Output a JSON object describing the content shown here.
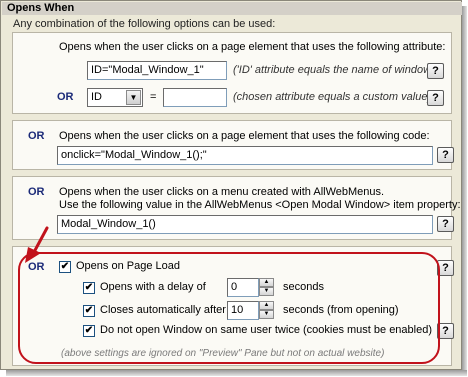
{
  "section": {
    "title": "Opens When",
    "subtitle": "Any combination of the following options can be used:"
  },
  "attribute_panel": {
    "description": "Opens when the user clicks on a page element that uses the following attribute:",
    "id_value": "ID=\"Modal_Window_1\"",
    "id_hint": "('ID' attribute equals the name of window)",
    "or_label": "OR",
    "attribute_select_value": "ID",
    "equals_sign": "=",
    "custom_value": "",
    "custom_hint": "(chosen attribute equals a custom value)"
  },
  "code_panel": {
    "or_label": "OR",
    "description": "Opens when the user clicks on a page element that uses the following code:",
    "code_value": "onclick=\"Modal_Window_1();\""
  },
  "menu_panel": {
    "or_label": "OR",
    "description_line1": "Opens when the user clicks on a menu created with AllWebMenus.",
    "description_line2": "Use the following value in the AllWebMenus <Open Modal Window> item property:",
    "menu_value": "Modal_Window_1()"
  },
  "page_load_panel": {
    "or_label": "OR",
    "opens_on_load_label": "Opens on Page Load",
    "opens_on_load_checked": true,
    "delay_label": "Opens with a delay of",
    "delay_checked": true,
    "delay_value": "0",
    "delay_unit": "seconds",
    "close_label": "Closes automatically after",
    "close_checked": true,
    "close_value": "10",
    "close_unit": "seconds (from opening)",
    "once_label": "Do not open Window on same user twice (cookies must be enabled)",
    "once_checked": true,
    "note": "(above settings are ignored on \"Preview\" Pane but not on actual website)"
  },
  "help_label": "?",
  "check_mark": "✔",
  "spin_up": "▲",
  "spin_down": "▼",
  "dropdown_arrow": "▼",
  "colors": {
    "background": "#ece9d8",
    "panel": "#fbfaf5",
    "or_text": "#1b2a78",
    "highlight": "#c1121b"
  }
}
